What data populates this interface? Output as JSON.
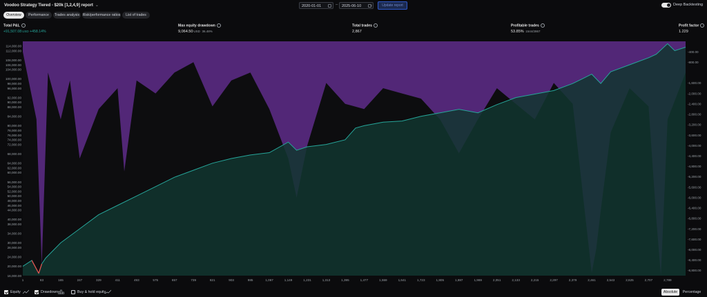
{
  "header": {
    "title": "Voodoo Strategy Tiered - $20k [1,2,4,9] report",
    "date_from": "2020-01-01",
    "date_to": "2025-06-10",
    "update_label": "Update report",
    "deep_backtesting_label": "Deep Backtesting",
    "deep_backtesting_on": true
  },
  "tabs": [
    {
      "label": "Overview",
      "active": true
    },
    {
      "label": "Performance",
      "active": false
    },
    {
      "label": "Trades analysis",
      "active": false
    },
    {
      "label": "Risk/performance ratios",
      "active": false
    },
    {
      "label": "List of trades",
      "active": false
    }
  ],
  "stats": {
    "total_pnl": {
      "label": "Total P&L",
      "value": "+91,507.08",
      "unit": "USD",
      "pct": "+458.14%"
    },
    "max_drawdown": {
      "label": "Max equity drawdown",
      "value": "9,064.50",
      "unit": "USD",
      "pct": "36.48%"
    },
    "total_trades": {
      "label": "Total trades",
      "value": "2,867"
    },
    "profitable_trades": {
      "label": "Profitable trades",
      "value": "53.85%",
      "detail": "1544/2867"
    },
    "profit_factor": {
      "label": "Profit factor",
      "value": "1.229"
    }
  },
  "colors": {
    "equity_line": "#26a69a",
    "equity_fill": "#12362f",
    "drawdown_fill": "#5a2a83",
    "loss_line": "#ef5350",
    "accent_blue": "#2962ff"
  },
  "chart_data": {
    "type": "area",
    "left_axis": {
      "ticks": [
        "114,000.00",
        "112,000.00",
        "108,000.00",
        "106,000.00",
        "104,000.00",
        "100,000.00",
        "98,000.00",
        "96,000.00",
        "92,000.00",
        "90,000.00",
        "88,000.00",
        "84,000.00",
        "80,000.00",
        "78,000.00",
        "76,000.00",
        "74,000.00",
        "72,000.00",
        "68,000.00",
        "64,000.00",
        "62,000.00",
        "60,000.00",
        "56,000.00",
        "54,000.00",
        "52,000.00",
        "50,000.00",
        "48,000.00",
        "46,000.00",
        "44,000.00",
        "40,000.00",
        "38,000.00",
        "34,000.00",
        "30,000.00",
        "28,000.00",
        "24,000.00",
        "20,000.00",
        "16,000.00"
      ],
      "ylim": [
        16000,
        116000
      ]
    },
    "right_axis": {
      "ticks": [
        "-400.00",
        "-800.00",
        "-1,600.00",
        "-2,000.00",
        "-2,400.00",
        "-2,800.00",
        "-3,200.00",
        "-3,600.00",
        "-4,000.00",
        "-4,400.00",
        "-4,800.00",
        "-5,200.00",
        "-5,600.00",
        "-6,000.00",
        "-6,400.00",
        "-6,800.00",
        "-7,200.00",
        "-7,600.00",
        "-8,000.00",
        "-8,400.00",
        "-8,800.00"
      ],
      "ylim": [
        -9000,
        0
      ]
    },
    "x_ticks": [
      "1",
      "83",
      "165",
      "247",
      "329",
      "411",
      "493",
      "575",
      "657",
      "739",
      "821",
      "903",
      "985",
      "1,067",
      "1,149",
      "1,231",
      "1,313",
      "1,395",
      "1,477",
      "1,559",
      "1,641",
      "1,723",
      "1,805",
      "1,887",
      "1,969",
      "2,051",
      "2,133",
      "2,215",
      "2,297",
      "2,379",
      "2,461",
      "2,543",
      "2,625",
      "2,707",
      "2,789"
    ],
    "xlim": [
      1,
      2867
    ],
    "series": [
      {
        "key": "equity",
        "x": [
          1,
          40,
          70,
          83,
          100,
          165,
          247,
          329,
          411,
          493,
          575,
          657,
          739,
          821,
          903,
          985,
          1067,
          1149,
          1185,
          1231,
          1313,
          1395,
          1440,
          1477,
          1559,
          1641,
          1723,
          1805,
          1887,
          1969,
          2051,
          2133,
          2215,
          2297,
          2379,
          2420,
          2461,
          2500,
          2543,
          2625,
          2707,
          2740,
          2789,
          2820,
          2867
        ],
        "y": [
          20000,
          22500,
          17000,
          21000,
          23500,
          30000,
          36000,
          42000,
          46000,
          50000,
          54000,
          58000,
          61000,
          64000,
          66000,
          67500,
          68500,
          73000,
          69500,
          71000,
          72000,
          74000,
          79000,
          80000,
          81500,
          82000,
          84000,
          85500,
          87000,
          85500,
          89000,
          92000,
          93500,
          95000,
          98000,
          100000,
          102000,
          98000,
          103000,
          106000,
          109000,
          110500,
          115000,
          112000,
          113500
        ]
      },
      {
        "key": "drawdown",
        "x": [
          1,
          60,
          83,
          110,
          165,
          205,
          247,
          329,
          411,
          440,
          493,
          575,
          657,
          739,
          821,
          903,
          985,
          1067,
          1149,
          1185,
          1231,
          1313,
          1395,
          1477,
          1559,
          1641,
          1723,
          1805,
          1887,
          1969,
          2051,
          2133,
          2215,
          2297,
          2379,
          2461,
          2480,
          2500,
          2543,
          2625,
          2707,
          2740,
          2760,
          2789,
          2867
        ],
        "y": [
          -400,
          -3000,
          -8600,
          -1200,
          -3000,
          -1500,
          -4500,
          -2600,
          -1800,
          -5000,
          -1500,
          -2000,
          -1200,
          -800,
          -2500,
          -1500,
          -1200,
          -2600,
          -4500,
          -6000,
          -4000,
          -1600,
          -2400,
          -2600,
          -1800,
          -2000,
          -2200,
          -3000,
          -4300,
          -3000,
          -1800,
          -2400,
          -3000,
          -1600,
          -2400,
          -8900,
          -8000,
          -6500,
          -3500,
          -1800,
          -2500,
          -6800,
          -9000,
          -3000,
          -1200
        ]
      }
    ]
  },
  "footer": {
    "equity_label": "Equity",
    "drawdown_label": "Drawdown",
    "buyhold_label": "Buy & hold equity",
    "absolute_label": "Absolute",
    "percentage_label": "Percentage"
  }
}
